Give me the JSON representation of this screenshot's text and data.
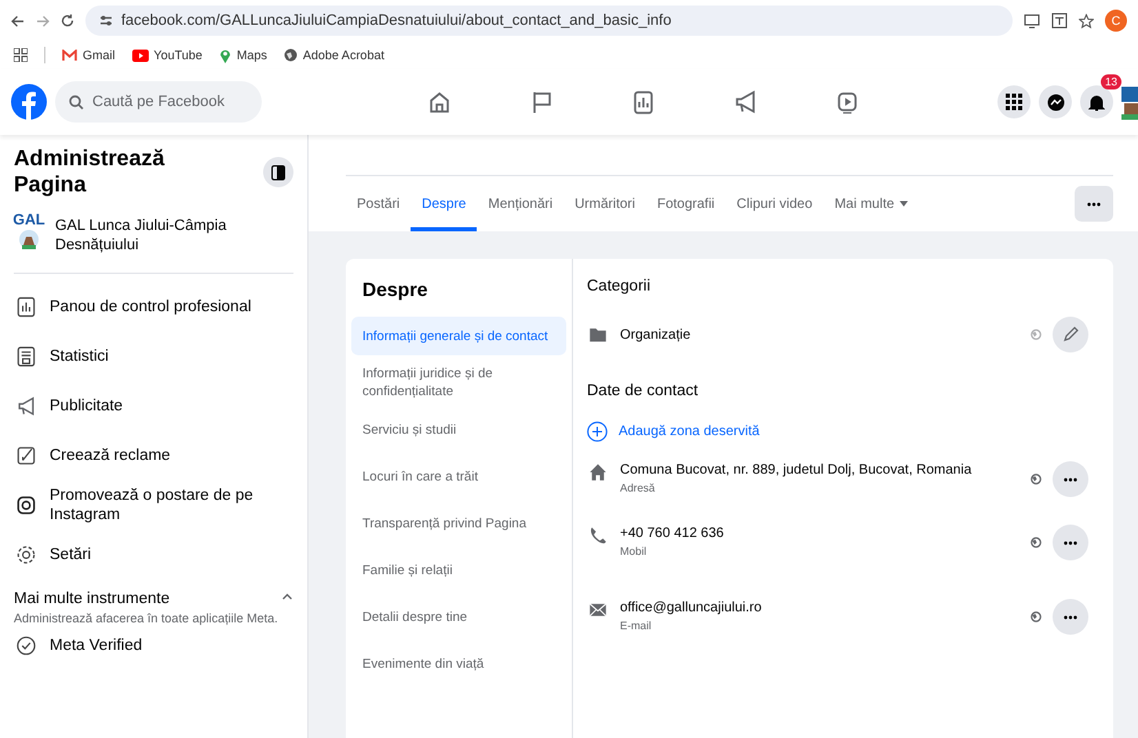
{
  "browser": {
    "url": "facebook.com/GALLuncaJiuluiCampiaDesnatuiului/about_contact_and_basic_info",
    "profile_initial": "C",
    "bookmarks": [
      {
        "label": "Gmail",
        "kind": "gmail"
      },
      {
        "label": "YouTube",
        "kind": "youtube"
      },
      {
        "label": "Maps",
        "kind": "maps"
      },
      {
        "label": "Adobe Acrobat",
        "kind": "globe"
      }
    ]
  },
  "header": {
    "search": {
      "placeholder": "Caută pe Facebook"
    },
    "notification_count": "13"
  },
  "sidebar": {
    "title": "Administrează Pagina",
    "page_name": "GAL Lunca Jiului-Câmpia Desnățuiului",
    "logo_text": "GAL",
    "items": [
      {
        "label": "Panou de control profesional",
        "kind": "dashboard"
      },
      {
        "label": "Statistici",
        "kind": "insights"
      },
      {
        "label": "Publicitate",
        "kind": "megaphone"
      },
      {
        "label": "Creează reclame",
        "kind": "pencil"
      },
      {
        "label": "Promovează o postare de pe Instagram",
        "kind": "instagram"
      },
      {
        "label": "Setări",
        "kind": "gear"
      }
    ],
    "more_tools": {
      "title": "Mai multe instrumente",
      "subtitle": "Administrează afacerea în toate aplicațiile Meta.",
      "expanded": true,
      "items": [
        {
          "label": "Meta Verified",
          "kind": "verified"
        }
      ]
    }
  },
  "tabs": [
    {
      "label": "Postări",
      "selected": false
    },
    {
      "label": "Despre",
      "selected": true
    },
    {
      "label": "Menționări",
      "selected": false
    },
    {
      "label": "Urmăritori",
      "selected": false
    },
    {
      "label": "Fotografii",
      "selected": false
    },
    {
      "label": "Clipuri video",
      "selected": false
    },
    {
      "label": "Mai multe",
      "selected": false,
      "kind": "dropdown"
    }
  ],
  "about": {
    "title": "Despre",
    "nav": [
      {
        "label": "Informații generale și de contact",
        "selected": true
      },
      {
        "label": "Informații juridice și de confidențialitate",
        "selected": false
      },
      {
        "label": "Serviciu și studii",
        "selected": false
      },
      {
        "label": "Locuri în care a trăit",
        "selected": false
      },
      {
        "label": "Transparență privind Pagina",
        "selected": false
      },
      {
        "label": "Familie și relații",
        "selected": false
      },
      {
        "label": "Detalii despre tine",
        "selected": false
      },
      {
        "label": "Evenimente din viață",
        "selected": false
      }
    ],
    "categories": {
      "title": "Categorii",
      "items": [
        {
          "label": "Organizație"
        }
      ]
    },
    "contact": {
      "title": "Date de contact",
      "add_link": "Adaugă zona deservită",
      "items": [
        {
          "kind": "address",
          "value": "Comuna Bucovat, nr. 889, judetul Dolj, Bucovat, Romania",
          "label": "Adresă"
        },
        {
          "kind": "phone",
          "value": "+40 760 412 636",
          "label": "Mobil"
        },
        {
          "kind": "email",
          "value": "office@galluncajiului.ro",
          "label": "E-mail"
        }
      ]
    }
  }
}
